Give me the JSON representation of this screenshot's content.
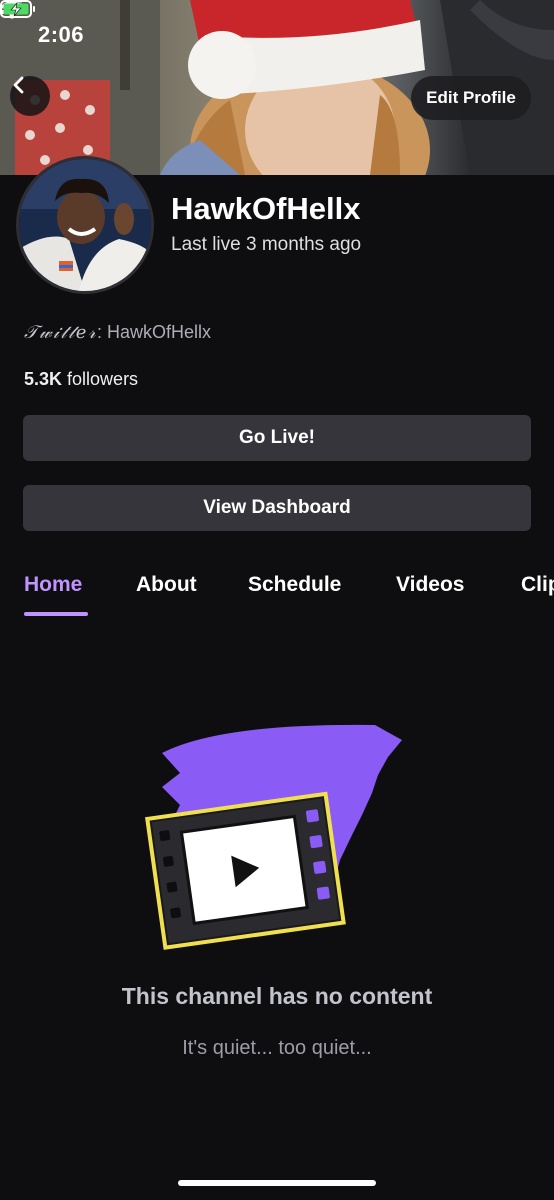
{
  "status_bar": {
    "time": "2:06"
  },
  "header": {
    "edit_profile_label": "Edit Profile"
  },
  "channel": {
    "name": "HawkOfHellx",
    "last_live": "Last live 3 months ago",
    "twitter_label": "𝒯𝓌𝒾𝓉𝓉𝑒𝓇",
    "twitter_handle": ": HawkOfHellx",
    "followers_count": "5.3K",
    "followers_label": " followers"
  },
  "actions": {
    "go_live": "Go Live!",
    "view_dashboard": "View Dashboard"
  },
  "tabs": [
    {
      "label": "Home",
      "active": true
    },
    {
      "label": "About"
    },
    {
      "label": "Schedule"
    },
    {
      "label": "Videos"
    },
    {
      "label": "Clips"
    }
  ],
  "empty_state": {
    "title": "This channel has no content",
    "subtitle": "It's quiet... too quiet..."
  },
  "colors": {
    "accent": "#bf94ff",
    "background": "#0e0e10",
    "button": "#35353b"
  }
}
